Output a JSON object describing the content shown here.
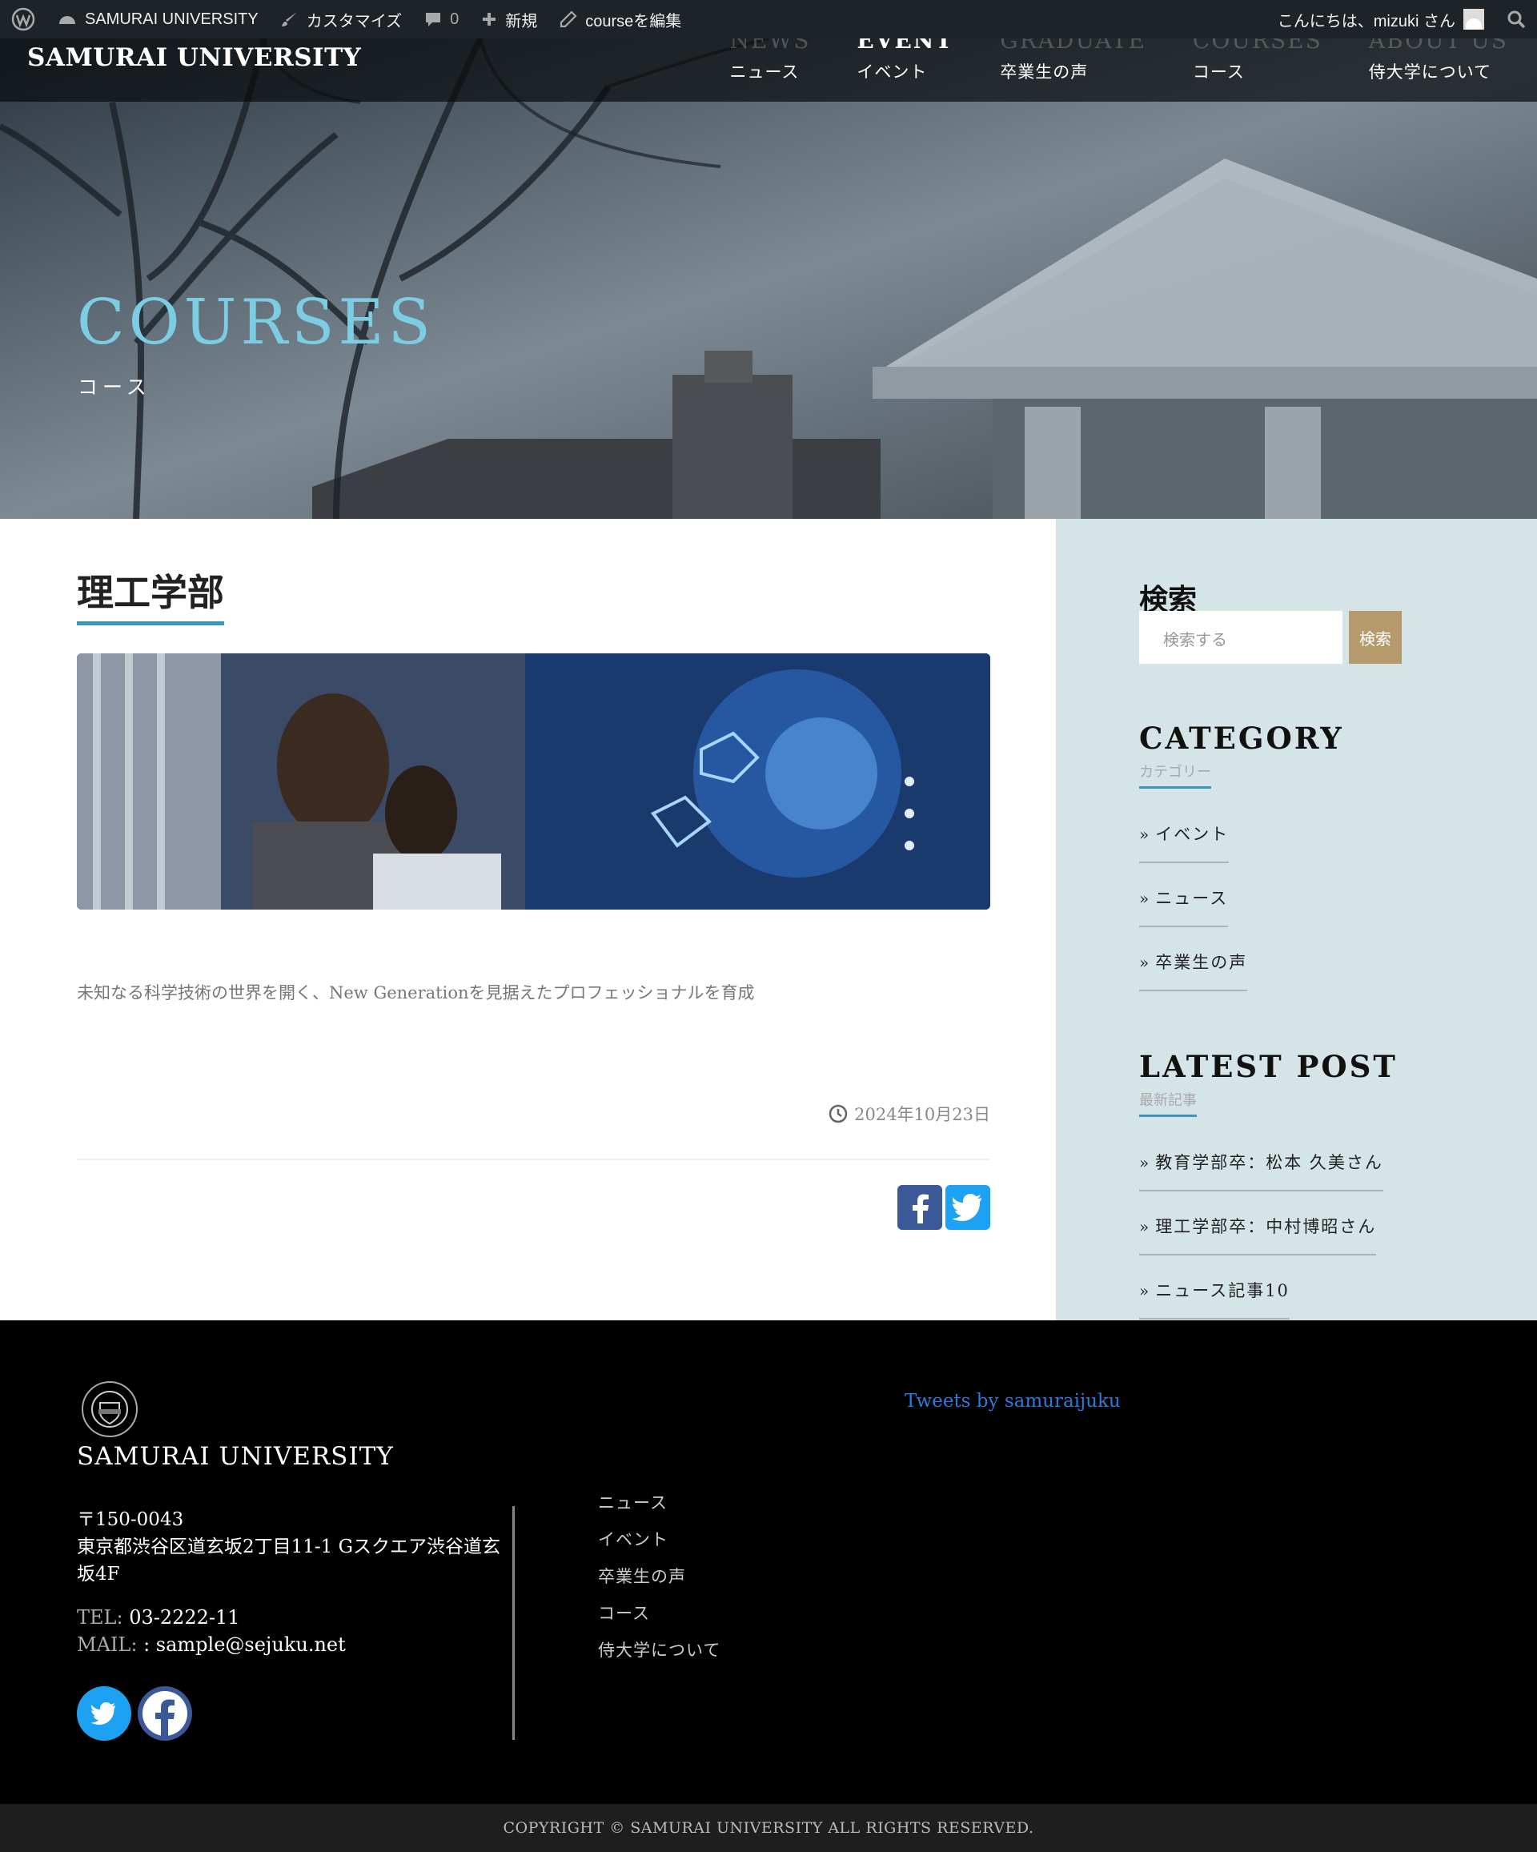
{
  "adminbar": {
    "site_name": "SAMURAI UNIVERSITY",
    "customize": "カスタマイズ",
    "comments_count": "0",
    "new": "新規",
    "edit": "courseを編集",
    "greeting": "こんにちは、mizuki さん"
  },
  "header": {
    "brand": "SAMURAI UNIVERSITY",
    "nav": [
      {
        "en": "NEWS",
        "ja": "ニュース"
      },
      {
        "en": "EVENT",
        "ja": "イベント"
      },
      {
        "en": "GRADUATE",
        "ja": "卒業生の声"
      },
      {
        "en": "COURSES",
        "ja": "コース"
      },
      {
        "en": "ABOUT US",
        "ja": "侍大学について"
      }
    ]
  },
  "hero": {
    "title": "COURSES",
    "subtitle": "コース"
  },
  "post": {
    "title": "理工学部",
    "excerpt": "未知なる科学技術の世界を開く、New Generationを見据えたプロフェッショナルを育成",
    "date": "2024年10月23日"
  },
  "sidebar": {
    "search_heading": "検索",
    "search_placeholder": "検索する",
    "search_button": "検索",
    "category_title": "CATEGORY",
    "category_sub": "カテゴリー",
    "categories": [
      "イベント",
      "ニュース",
      "卒業生の声"
    ],
    "latest_title": "LATEST POST",
    "latest_sub": "最新記事",
    "latest_posts": [
      "教育学部卒：松本 久美さん",
      "理工学部卒：中村博昭さん",
      "ニュース記事10"
    ]
  },
  "footer": {
    "brand": "SAMURAI UNIVERSITY",
    "postal": "〒150-0043",
    "address": "東京都渋谷区道玄坂2丁目11-1 Gスクエア渋谷道玄坂4F",
    "tel_label": "TEL:",
    "tel": "03-2222-11",
    "mail_label": "MAIL:",
    "mail": ": sample@sejuku.net",
    "nav": [
      "ニュース",
      "イベント",
      "卒業生の声",
      "コース",
      "侍大学について"
    ],
    "tweets": "Tweets by samuraijuku",
    "copyright": "COPYRIGHT © SAMURAI UNIVERSITY ALL RIGHTS RESERVED."
  },
  "colors": {
    "accent": "#3a97b7",
    "hero_title": "#7ccde3",
    "search_button": "#b59b6b",
    "sidebar_bg": "#d5e4e7"
  }
}
